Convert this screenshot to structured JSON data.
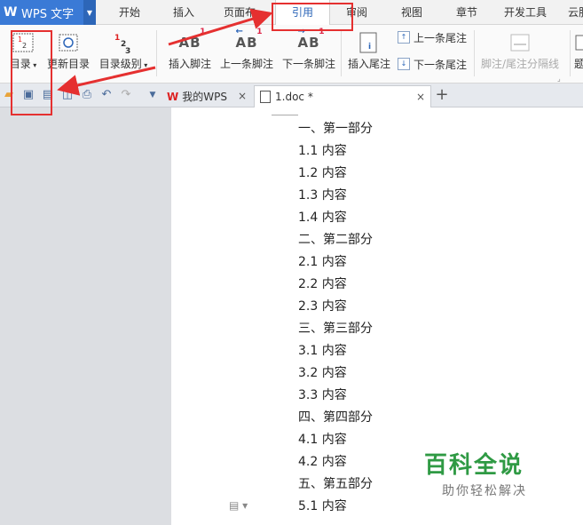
{
  "app": {
    "title": "WPS 文字"
  },
  "menu": {
    "items": [
      "开始",
      "插入",
      "页面布",
      "引用",
      "审阅",
      "视图",
      "章节",
      "开发工具",
      "云服"
    ],
    "active": "引用"
  },
  "ribbon": {
    "toc": "目录",
    "update_toc": "更新目录",
    "toc_level": "目录级别",
    "insert_footnote": "插入脚注",
    "prev_footnote": "上一条脚注",
    "next_footnote": "下一条脚注",
    "insert_endnote": "插入尾注",
    "prev_endnote": "上一条尾注",
    "next_endnote": "下一条尾注",
    "separator": "脚注/尾注分隔线",
    "more": "题"
  },
  "tabs": [
    {
      "label": "我的WPS"
    },
    {
      "label": "1.doc *"
    }
  ],
  "document": {
    "lines": [
      "一、第一部分",
      "1.1 内容",
      "1.2 内容",
      "1.3 内容",
      "1.4 内容",
      "二、第二部分",
      "2.1 内容",
      "2.2 内容",
      "2.3 内容",
      "三、第三部分",
      "3.1 内容",
      "3.2 内容",
      "3.3 内容",
      "四、第四部分",
      "4.1 内容",
      "4.2 内容",
      "五、第五部分",
      "5.1 内容"
    ]
  },
  "watermark": {
    "big": "百科全说",
    "small": "助你轻松解决"
  },
  "colors": {
    "accent": "#3a7ad6",
    "annotation": "#e53030",
    "watermark": "#2f9a44"
  }
}
